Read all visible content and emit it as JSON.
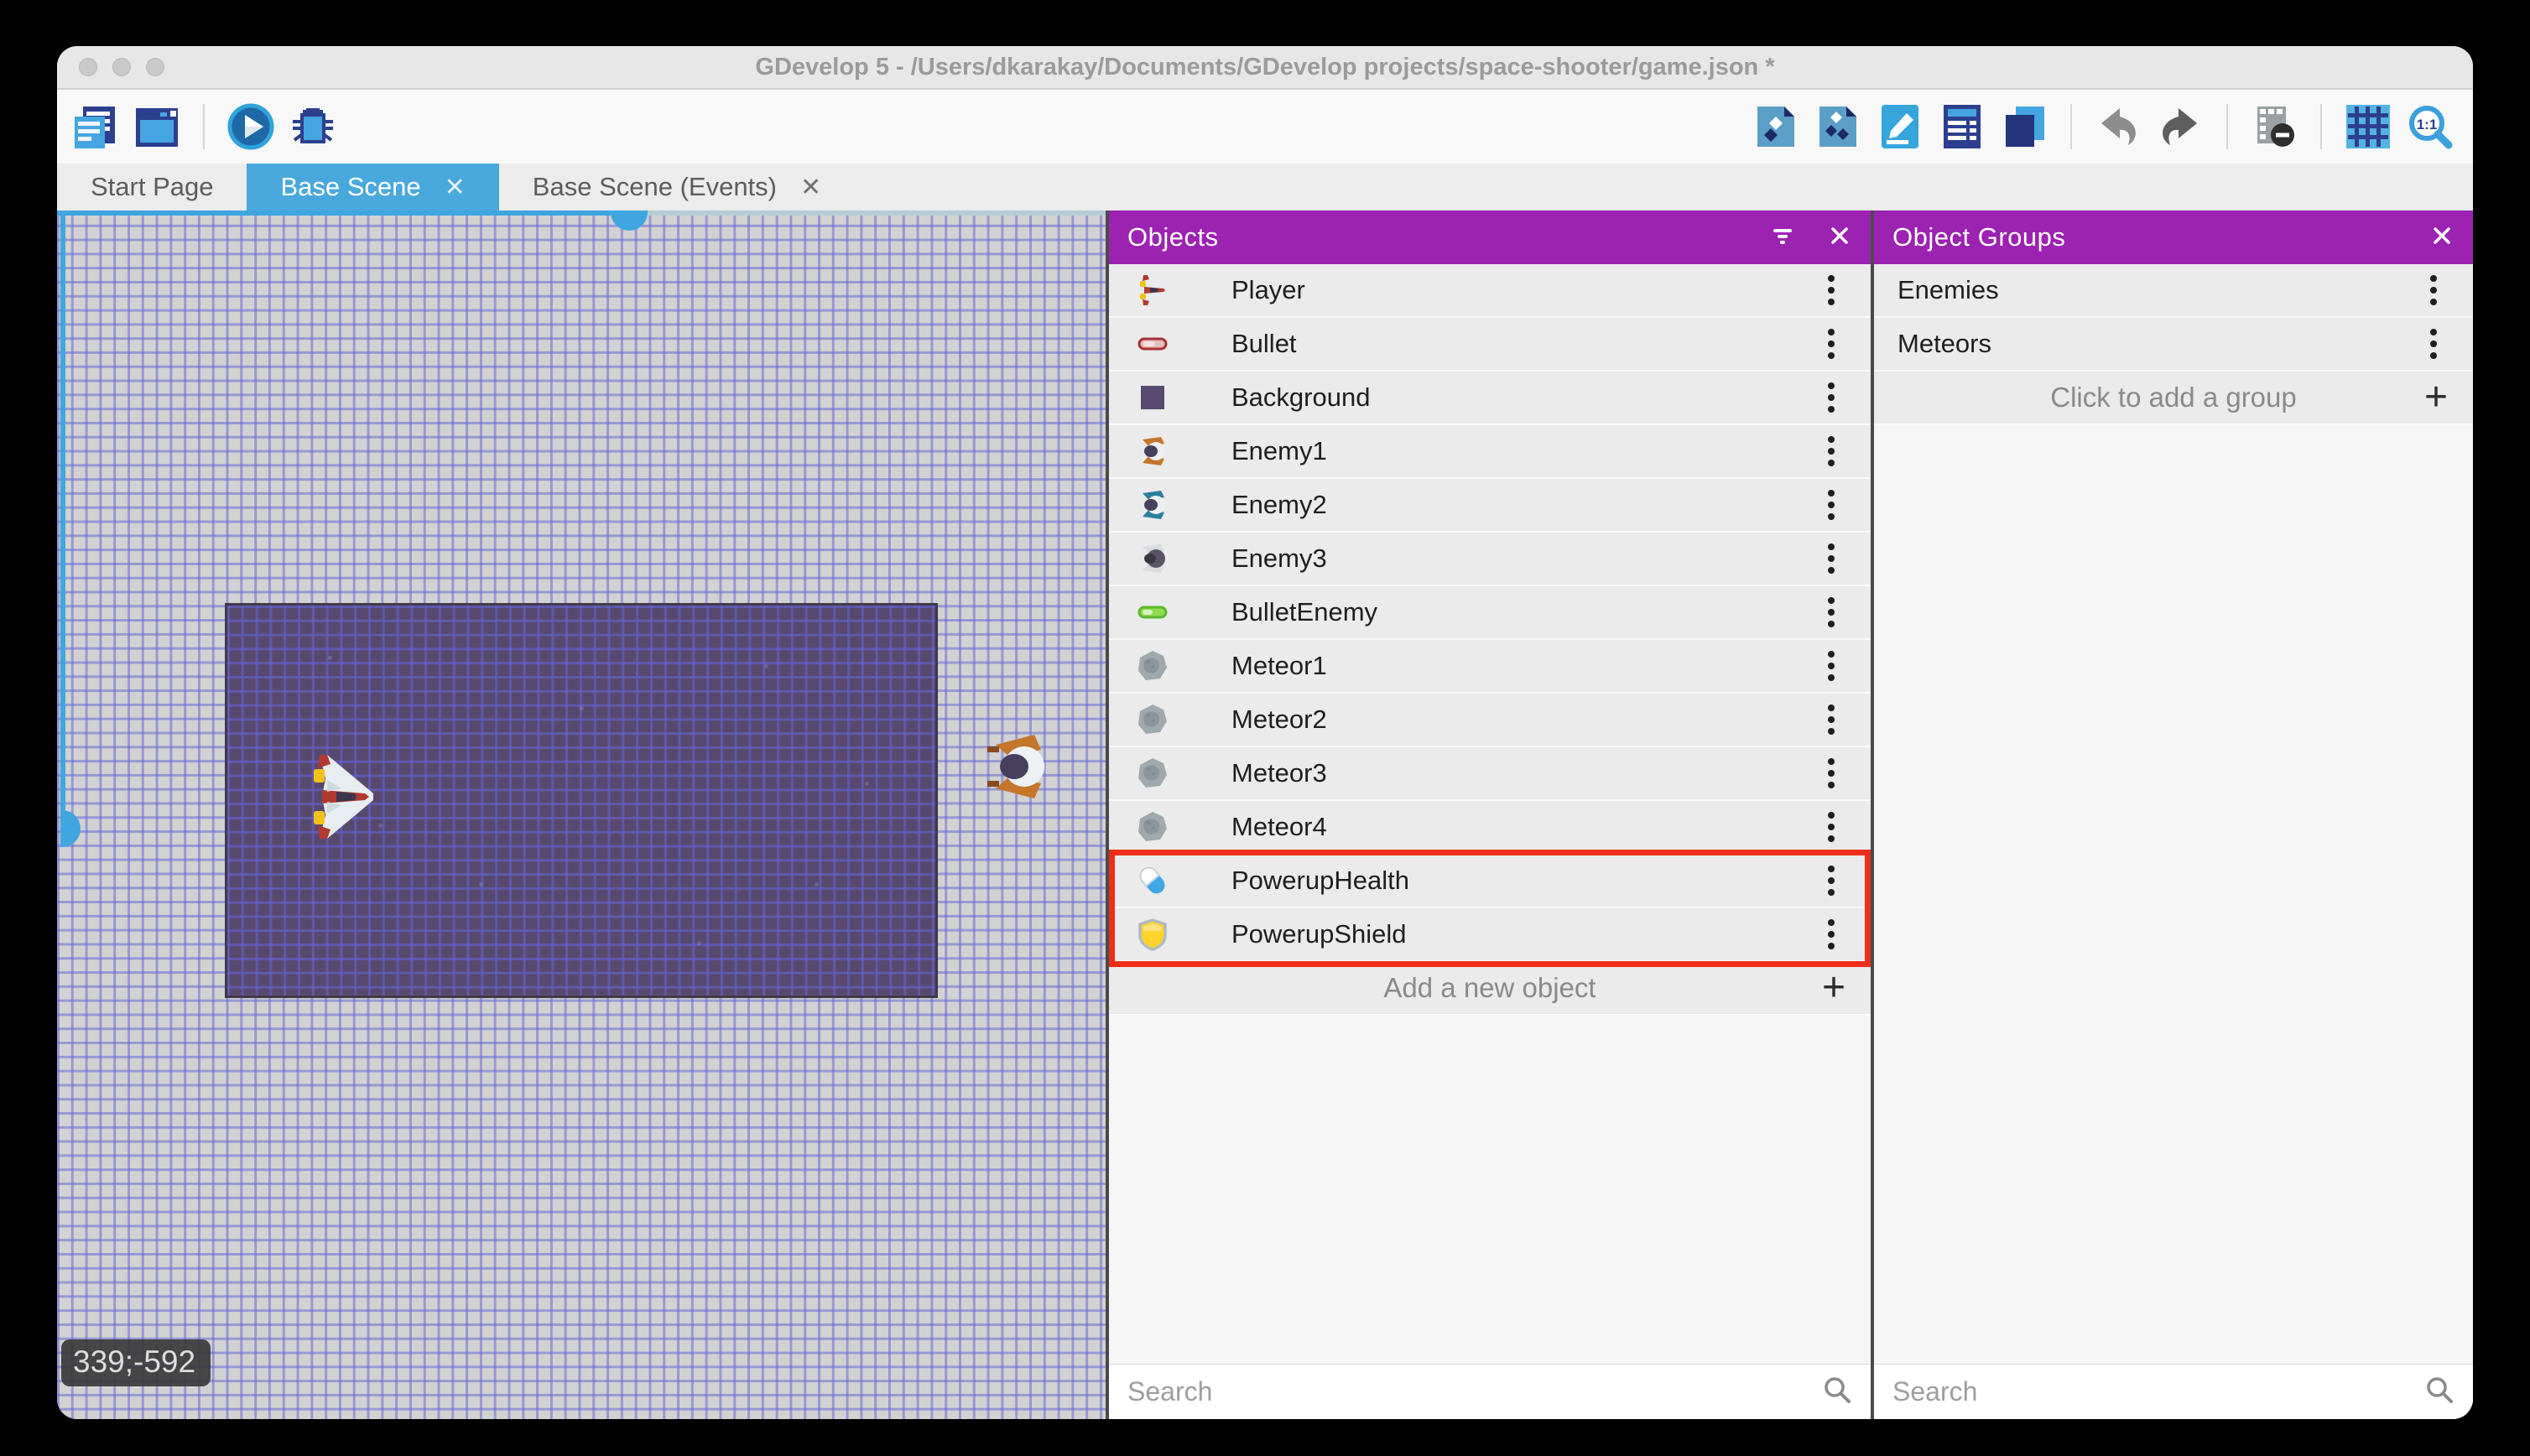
{
  "window": {
    "title": "GDevelop 5 - /Users/dkarakay/Documents/GDevelop projects/space-shooter/game.json *",
    "controls": [
      "close",
      "minimize",
      "maximize"
    ]
  },
  "toolbar": {
    "left": [
      "project-manager",
      "preview",
      "|",
      "play",
      "debug"
    ],
    "right": [
      "objects-panel",
      "object-groups-panel",
      "properties-panel",
      "instances-list-panel",
      "layers-panel",
      "|",
      "undo",
      "redo",
      "|",
      "toggle-mask",
      "|",
      "toggle-grid",
      "zoom-1-1"
    ]
  },
  "tabs": [
    {
      "label": "Start Page",
      "active": false,
      "closable": false
    },
    {
      "label": "Base Scene",
      "active": true,
      "closable": true
    },
    {
      "label": "Base Scene (Events)",
      "active": false,
      "closable": true
    }
  ],
  "canvas": {
    "coordinates": "339;-592"
  },
  "objects_panel": {
    "title": "Objects",
    "header_icons": [
      "filter",
      "close"
    ],
    "items": [
      {
        "label": "Player",
        "icon": "player-ship"
      },
      {
        "label": "Bullet",
        "icon": "bullet-red"
      },
      {
        "label": "Background",
        "icon": "background-square"
      },
      {
        "label": "Enemy1",
        "icon": "enemy-orange"
      },
      {
        "label": "Enemy2",
        "icon": "enemy-teal"
      },
      {
        "label": "Enemy3",
        "icon": "enemy-gray"
      },
      {
        "label": "BulletEnemy",
        "icon": "bullet-green"
      },
      {
        "label": "Meteor1",
        "icon": "meteor"
      },
      {
        "label": "Meteor2",
        "icon": "meteor"
      },
      {
        "label": "Meteor3",
        "icon": "meteor"
      },
      {
        "label": "Meteor4",
        "icon": "meteor"
      },
      {
        "label": "PowerupHealth",
        "icon": "powerup-health",
        "highlighted": true
      },
      {
        "label": "PowerupShield",
        "icon": "powerup-shield",
        "highlighted": true
      }
    ],
    "add_label": "Add a new object",
    "search_placeholder": "Search"
  },
  "groups_panel": {
    "title": "Object Groups",
    "header_icons": [
      "close"
    ],
    "items": [
      {
        "label": "Enemies"
      },
      {
        "label": "Meteors"
      }
    ],
    "add_label": "Click to add a group",
    "search_placeholder": "Search"
  },
  "colors": {
    "accent_blue": "#49a8dc",
    "panel_purple": "#9c22b1",
    "highlight_red": "#ee2e1b",
    "scene_background": "#57496e",
    "grid_line": "#6a6ad6",
    "canvas_background": "#d2d2d2"
  }
}
